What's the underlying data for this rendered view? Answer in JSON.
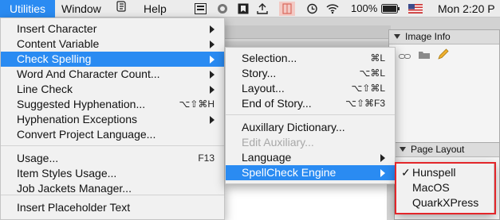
{
  "menubar": {
    "items": [
      "Utilities",
      "Window",
      "Help"
    ],
    "status": {
      "battery": "100%",
      "clock": "Mon 2:20 P"
    }
  },
  "background": {
    "image_info": "Image Info",
    "page_layout": "Page Layout"
  },
  "utilities_menu": [
    {
      "label": "Insert Character",
      "arrow": true
    },
    {
      "label": "Content Variable",
      "arrow": true
    },
    {
      "label": "Check Spelling",
      "arrow": true,
      "selected": true
    },
    {
      "label": "Word And Character Count...",
      "arrow": true
    },
    {
      "label": "Line Check",
      "arrow": true
    },
    {
      "label": "Suggested Hyphenation...",
      "shortcut": "⌥⇧⌘H"
    },
    {
      "label": "Hyphenation Exceptions",
      "arrow": true
    },
    {
      "label": "Convert Project Language..."
    },
    {
      "label": "Usage...",
      "shortcut": "F13"
    },
    {
      "label": "Item Styles Usage..."
    },
    {
      "label": "Job Jackets Manager..."
    },
    {
      "label": "Insert Placeholder Text"
    }
  ],
  "check_spelling_menu": [
    {
      "label": "Selection...",
      "shortcut": "⌘L"
    },
    {
      "label": "Story...",
      "shortcut": "⌥⌘L"
    },
    {
      "label": "Layout...",
      "shortcut": "⌥⇧⌘L"
    },
    {
      "label": "End of Story...",
      "shortcut": "⌥⇧⌘F3"
    },
    {
      "label": "Auxillary Dictionary..."
    },
    {
      "label": "Edit Auxiliary...",
      "disabled": true
    },
    {
      "label": "Language",
      "arrow": true
    },
    {
      "label": "SpellCheck Engine",
      "arrow": true,
      "selected": true
    }
  ],
  "spellcheck_engine_menu": [
    {
      "label": "Hunspell",
      "checked": true,
      "check": "✓"
    },
    {
      "label": "MacOS"
    },
    {
      "label": "QuarkXPress"
    }
  ]
}
